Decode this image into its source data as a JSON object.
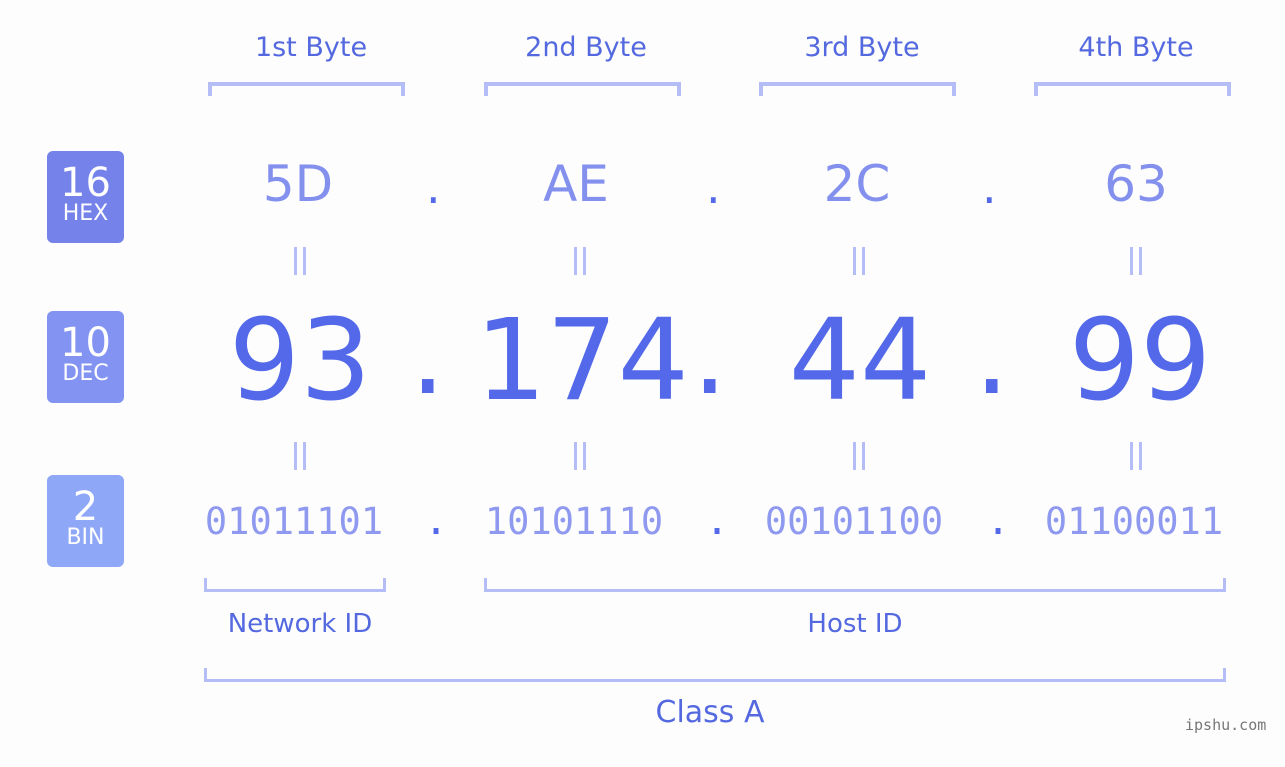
{
  "headers": [
    "1st Byte",
    "2nd Byte",
    "3rd Byte",
    "4th Byte"
  ],
  "badges": {
    "hex": {
      "num": "16",
      "label": "HEX",
      "color": "#7482ea"
    },
    "dec": {
      "num": "10",
      "label": "DEC",
      "color": "#8393f1"
    },
    "bin": {
      "num": "2",
      "label": "BIN",
      "color": "#8fa7f7"
    }
  },
  "hex": [
    "5D",
    "AE",
    "2C",
    "63"
  ],
  "dec": [
    "93",
    "174",
    "44",
    "99"
  ],
  "bin": [
    "01011101",
    "10101110",
    "00101100",
    "01100011"
  ],
  "separator": ".",
  "labels": {
    "network_id": "Network ID",
    "host_id": "Host ID",
    "class": "Class A"
  },
  "watermark": "ipshu.com",
  "colors": {
    "accent": "#5469e9",
    "bracket": "#b4bdf6",
    "hex_text": "#8490ee",
    "bin_text": "#8e99ef"
  }
}
